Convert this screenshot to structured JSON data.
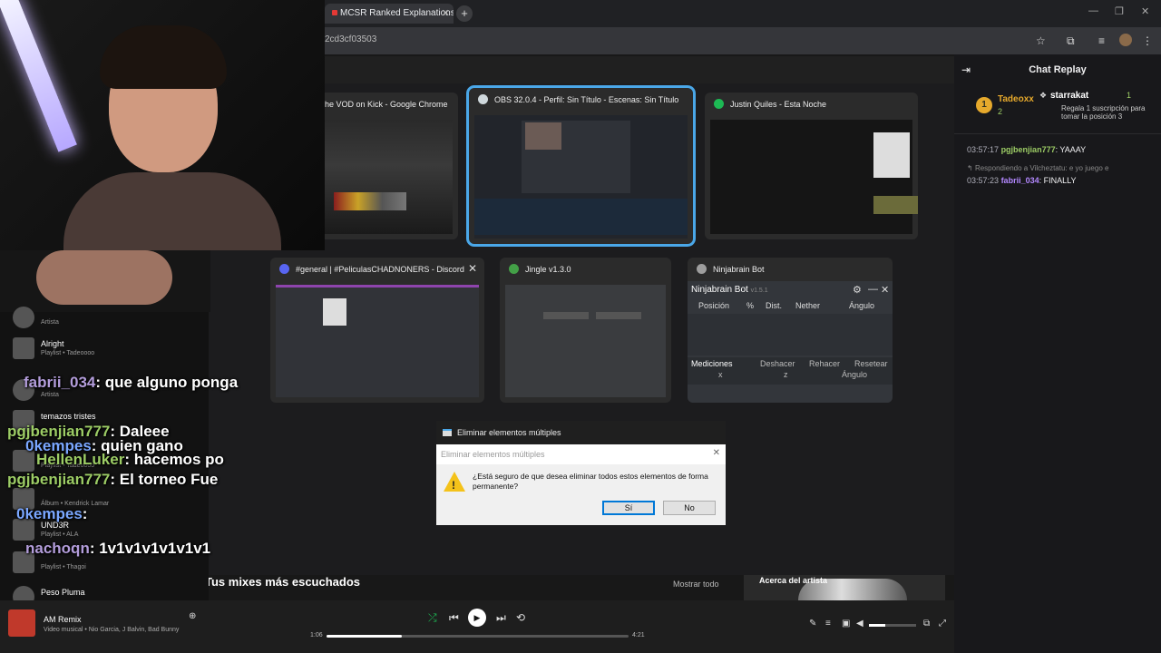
{
  "browser": {
    "tab_title": "MCSR Ranked Explanations | Th",
    "tab_close": "✕",
    "new_tab": "+",
    "url_fragment": "2cd3cf03503",
    "window_controls": [
      "—",
      "❐",
      "✕"
    ]
  },
  "switcher": {
    "windows": [
      {
        "title": "he VOD on Kick - Google Chrome",
        "icon": "chrome-icon",
        "icon_color": "#4caf50"
      },
      {
        "title": "OBS 32.0.4 - Perfil: Sin Título - Escenas: Sin Título",
        "icon": "obs-icon",
        "icon_color": "#cfd8dc",
        "selected": true
      },
      {
        "title": "Justin Quiles - Esta Noche",
        "icon": "spotify-icon",
        "icon_color": "#1db954"
      },
      {
        "title": "#general | #PeliculasCHADNONERS - Discord",
        "icon": "discord-icon",
        "icon_color": "#5865f2",
        "close": "✕"
      },
      {
        "title": "Jingle v1.3.0",
        "icon": "jingle-icon",
        "icon_color": "#43a047"
      },
      {
        "title": "Ninjabrain Bot",
        "icon": "ninjabrain-icon",
        "icon_color": "#9e9e9e"
      }
    ],
    "ninjabrain": {
      "header": "Ninjabrain Bot",
      "version": "v1.5.1",
      "columns": [
        "Posición",
        "%",
        "Dist.",
        "Nether",
        "Ángulo"
      ],
      "measurements_label": "Mediciones",
      "actions": [
        "Deshacer",
        "Rehacer",
        "Resetear"
      ],
      "meas_cols": [
        "x",
        "z",
        "Ángulo"
      ]
    }
  },
  "dialog": {
    "outer_title": "Eliminar elementos múltiples",
    "inner_title": "Eliminar elementos múltiples",
    "message": "¿Está seguro de que desea eliminar todos estos elementos de forma permanente?",
    "yes": "Sí",
    "no": "No",
    "close": "✕"
  },
  "music": {
    "mixes_title": "Tus mixes más escuchados",
    "show_all": "Mostrar todo",
    "about_artist": "Acerca del artista",
    "sidebar": [
      {
        "name": "",
        "sub": "Artista"
      },
      {
        "name": "Alright",
        "sub": "Playlist • Tadeoooo"
      },
      {
        "name": "",
        "sub": "Artista"
      },
      {
        "name": "temazos tristes",
        "sub": ""
      },
      {
        "name": "",
        "sub": "Playlist • Tadeoooo"
      },
      {
        "name": "",
        "sub": "Álbum • Kendrick Lamar"
      },
      {
        "name": "UND3R",
        "sub": "Playlist • ALA"
      },
      {
        "name": "",
        "sub": "Playlist • Thagoi"
      },
      {
        "name": "Peso Pluma",
        "sub": ""
      }
    ],
    "player": {
      "title": "AM Remix",
      "subtitle": "Video musical • Nio Garcia, J Balvin, Bad Bunny",
      "elapsed": "1:06",
      "total": "4:21",
      "progress": 0.25,
      "volume": 0.35
    }
  },
  "stream_chat_overlay": [
    {
      "user": "fabrii_034",
      "msg": ": que alguno ponga",
      "color": "purple"
    },
    {
      "user": "pgjbenjian777",
      "msg": ": Daleee",
      "color": "green"
    },
    {
      "user": "0kempes",
      "msg": ": quien gano",
      "color": "blue"
    },
    {
      "user": "HellenLuker",
      "msg": ": hacemos po",
      "color": "green"
    },
    {
      "user": "pgjbenjian777",
      "msg": ": El torneo Fue",
      "color": "green"
    },
    {
      "user": "0kempes",
      "msg": ":",
      "color": "blue"
    },
    {
      "user": "nachoqn",
      "msg": ": 1v1v1v1v1v1v1",
      "color": "purple"
    }
  ],
  "chat_replay": {
    "title": "Chat Replay",
    "top_user": "Tadeoxx",
    "top_rank": "1",
    "top_count": "2",
    "gift_user": "starrakat",
    "gift_count": "1",
    "gift_text": "Regala 1 suscripción para tomar la posición 3",
    "messages": [
      {
        "time": "03:57:17",
        "user": "pgjbenjian777",
        "text": ": YAAAY",
        "color": "green"
      },
      {
        "reply": "Respondiendo a Vilcheztatu: e yo juego e"
      },
      {
        "time": "03:57:23",
        "user": "fabrii_034",
        "text": ": FINALLY",
        "color": "purple"
      }
    ]
  }
}
